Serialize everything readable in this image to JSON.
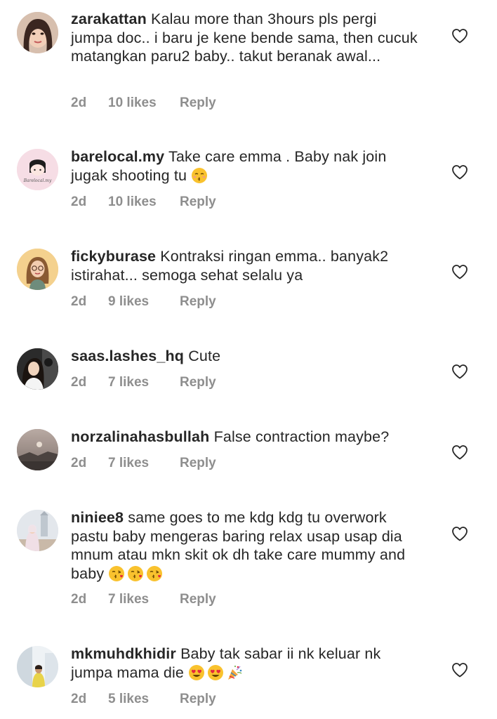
{
  "comments": [
    {
      "username": "zarakattan",
      "text": "Kalau more than 3hours pls pergi jumpa doc.. i baru je kene bende sama, then cucuk matangkan paru2 baby.. takut beranak awal...",
      "time": "2d",
      "likes": "10 likes",
      "reply": "Reply",
      "emojis": []
    },
    {
      "username": "barelocal.my",
      "text": "Take care emma . Baby nak join jugak shooting tu",
      "time": "2d",
      "likes": "10 likes",
      "reply": "Reply",
      "emojis": [
        "kissing-face"
      ]
    },
    {
      "username": "fickyburase",
      "text": "Kontraksi ringan emma.. banyak2 istirahat... semoga sehat selalu ya",
      "time": "2d",
      "likes": "9 likes",
      "reply": "Reply",
      "emojis": []
    },
    {
      "username": "saas.lashes_hq",
      "text": "Cute",
      "time": "2d",
      "likes": "7 likes",
      "reply": "Reply",
      "emojis": []
    },
    {
      "username": "norzalinahasbullah",
      "text": "False contraction maybe?",
      "time": "2d",
      "likes": "7 likes",
      "reply": "Reply",
      "emojis": []
    },
    {
      "username": "niniee8",
      "text": "same goes to me kdg kdg tu overwork pastu baby mengeras baring relax usap usap dia mnum atau mkn skit ok dh take care mummy and baby",
      "time": "2d",
      "likes": "7 likes",
      "reply": "Reply",
      "emojis": [
        "kiss-face",
        "kiss-face",
        "kiss-face"
      ]
    },
    {
      "username": "mkmuhdkhidir",
      "text": "Baby tak sabar ii nk keluar nk jumpa mama die",
      "time": "2d",
      "likes": "5 likes",
      "reply": "Reply",
      "emojis": [
        "heart-eyes-face",
        "heart-eyes-face",
        "party-popper"
      ]
    }
  ],
  "avatar_labels": {
    "barelocal": "Barelocal.my"
  },
  "colors": {
    "text": "#262626",
    "meta": "#8e8e8e",
    "heart_stroke": "#262626",
    "emoji_yellow": "#F9C22E",
    "emoji_red": "#E5283C"
  }
}
